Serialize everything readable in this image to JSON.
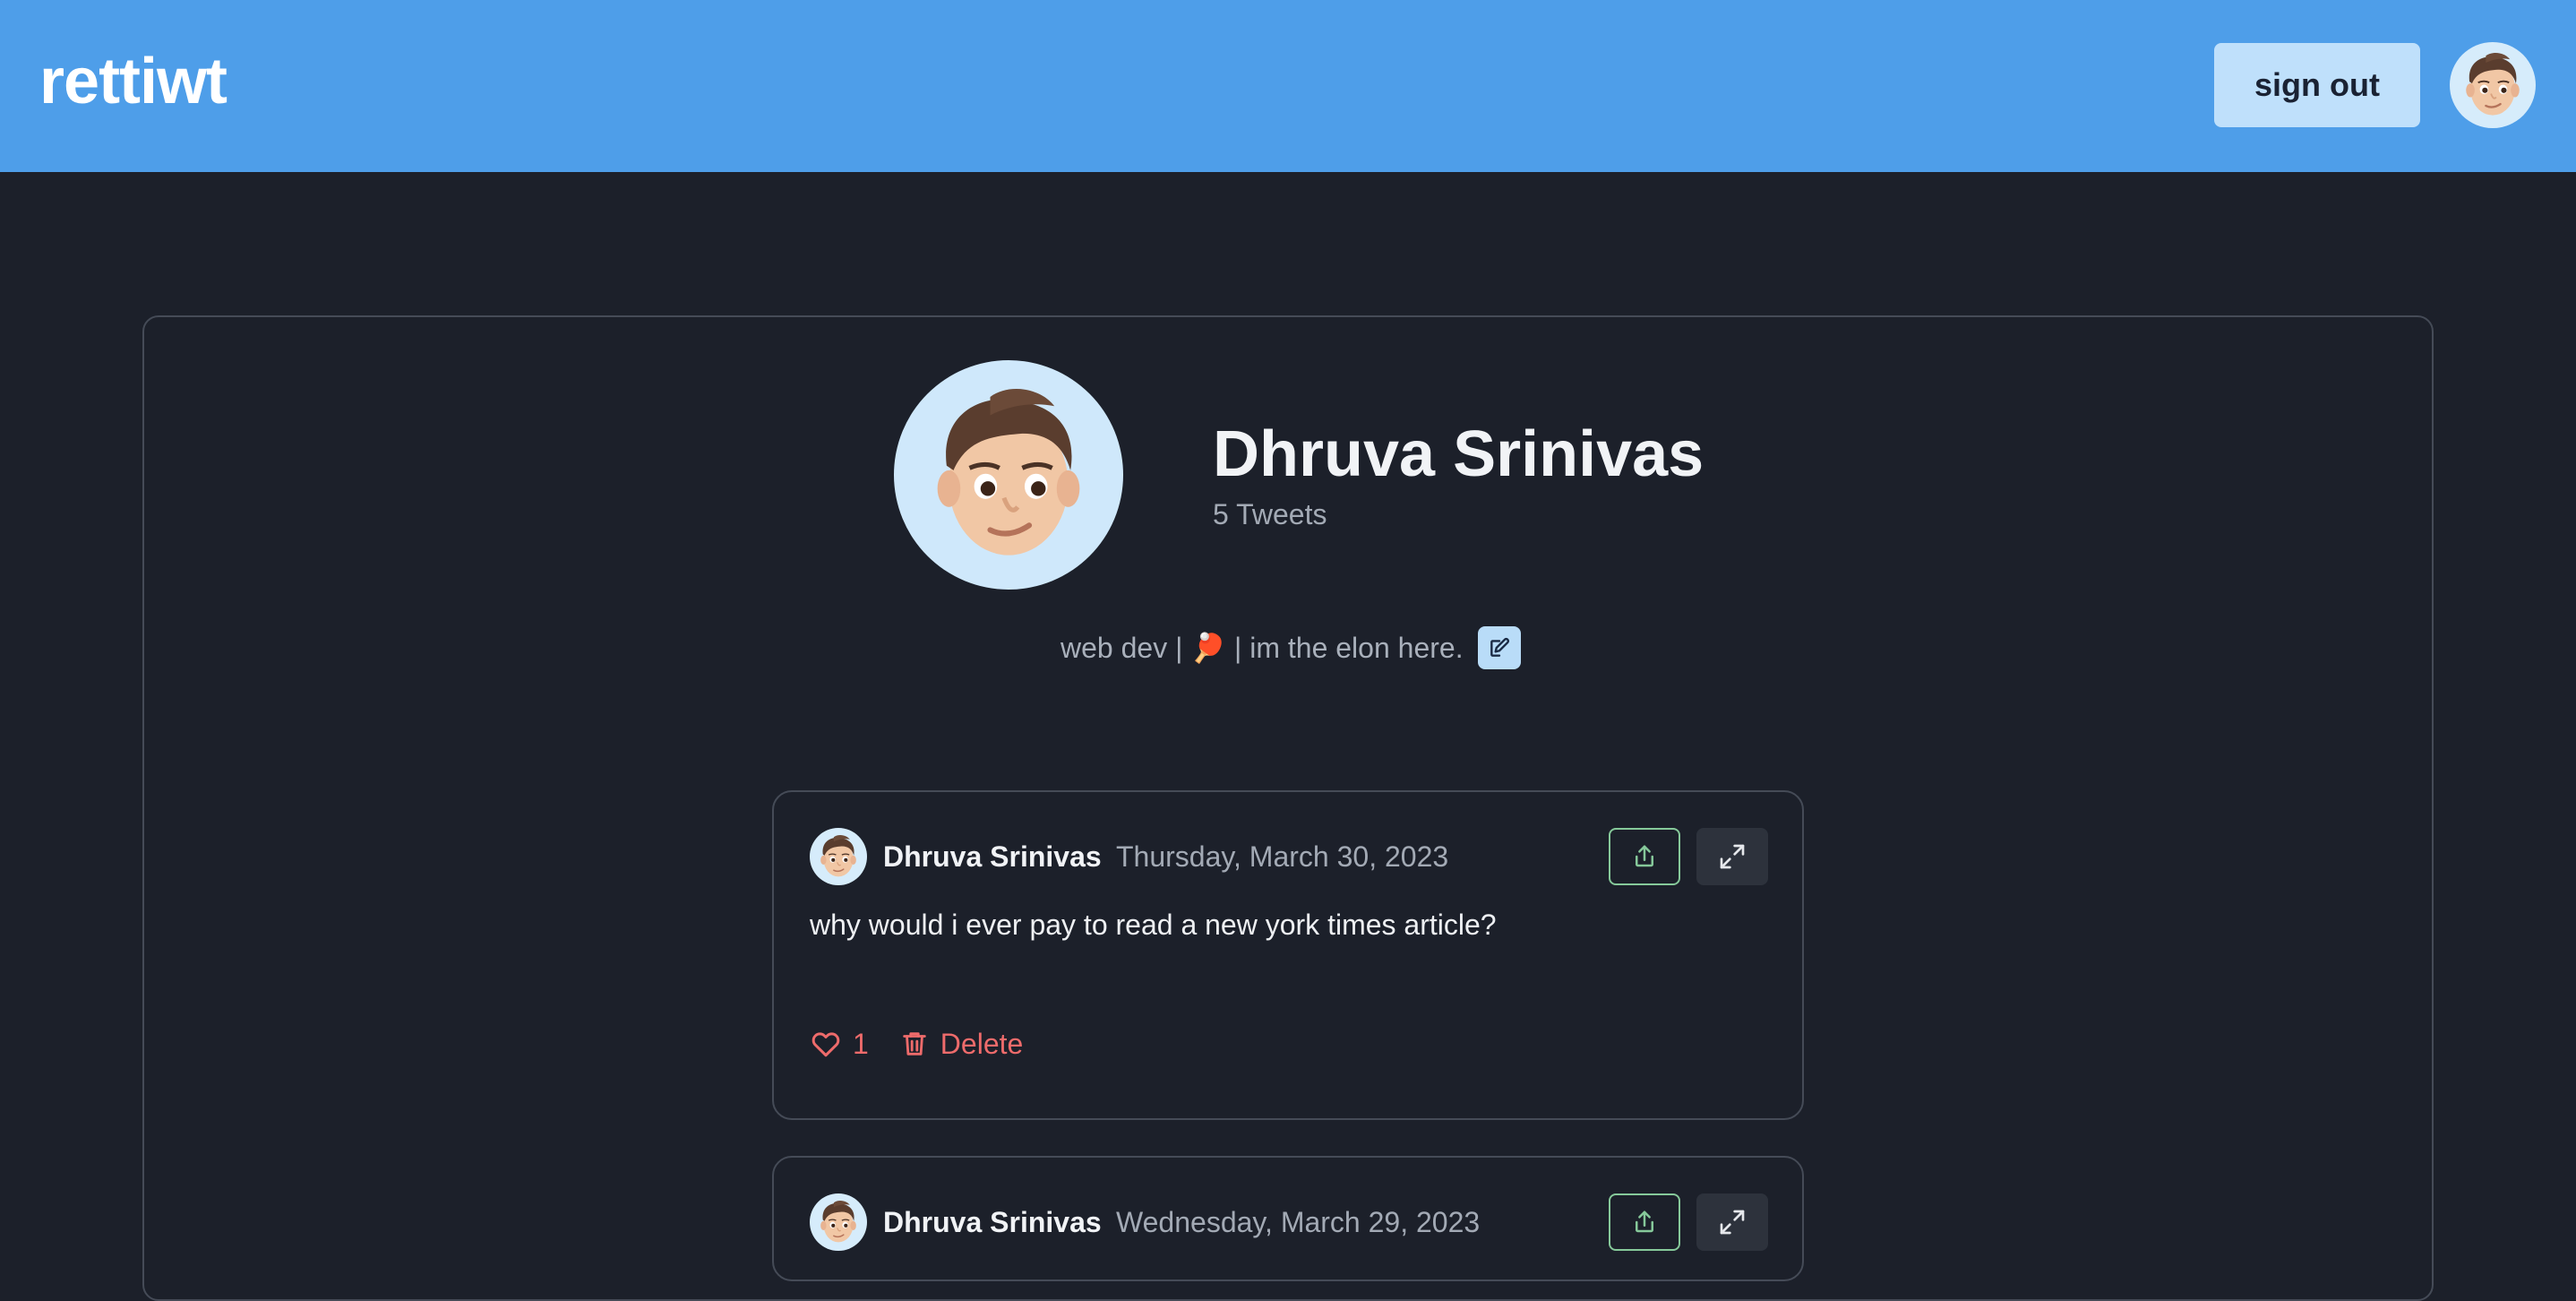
{
  "header": {
    "brand": "rettiwt",
    "sign_out_label": "sign out"
  },
  "profile": {
    "name": "Dhruva Srinivas",
    "tweet_count": "5 Tweets",
    "bio": "web dev | 🏓 | im the elon here."
  },
  "tweets": [
    {
      "author": "Dhruva Srinivas",
      "date": "Thursday, March 30, 2023",
      "text": "why would i ever pay to read a new york times article?",
      "likes": "1",
      "delete_label": "Delete"
    },
    {
      "author": "Dhruva Srinivas",
      "date": "Wednesday, March 29, 2023"
    }
  ],
  "icons": {
    "avatar": "memoji-avatar-icon",
    "edit": "edit-icon",
    "share": "share-icon",
    "expand": "expand-icon",
    "like": "heart-icon",
    "delete": "trash-icon"
  },
  "colors": {
    "header_bg": "#4e9ee9",
    "page_bg": "#1c202a",
    "accent_red": "#ee6b6b",
    "share_green": "#86c99a"
  }
}
